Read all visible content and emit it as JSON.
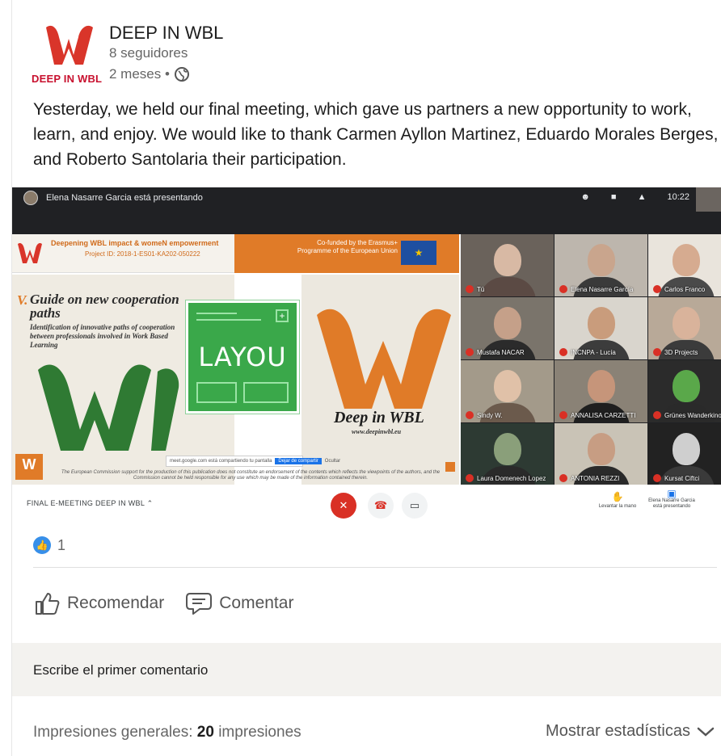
{
  "post": {
    "company_name": "DEEP IN WBL",
    "logo_text": "DEEP IN WBL",
    "followers": "8 seguidores",
    "time": "2 meses •",
    "body": "Yesterday, we held our final meeting, which gave us partners a new opportunity to work, learn, and enjoy. We would like to thank Carmen Ayllon Martinez, Eduardo Morales Berges, and Roberto Santolaria their participation."
  },
  "media": {
    "presenting_banner": "Elena Nasarre Garcia está presentando",
    "clock": "10:22",
    "slide": {
      "header_title": "Deepening WBL impact & womeN empowerment",
      "project_id": "Project ID: 2018-1-ES01-KA202-050222",
      "mini_logo_text": "DEEP IN WBL",
      "cofunded": "Co-funded by the Erasmus+ Programme of the European Union",
      "guide_number": "V.",
      "guide_title": "Guide on new cooperation paths",
      "guide_subtitle": "Identification of innovative paths of cooperation between professionals involved in Work Based Learning",
      "layou_label": "LAYOU",
      "deep_title": "Deep in WBL",
      "deep_url": "www.deepinwbl.eu",
      "share_text": "meet.google.com está compartiendo tu pantalla",
      "share_button": "Dejar de compartir",
      "share_hide": "Ocultar",
      "disclaimer": "The European Commission support for the production of this publication does not constitute an endorsement of the contents which reflects the viewpoints of the authors, and the Commission cannot be held responsible for any use which may be made of the information contained therein."
    },
    "participants": [
      {
        "name": "Tú"
      },
      {
        "name": "Elena Nasarre García"
      },
      {
        "name": "Carlos Franco"
      },
      {
        "name": "Mustafa NACAR"
      },
      {
        "name": "INCNPA - Lucía"
      },
      {
        "name": "3D Projects"
      },
      {
        "name": "Sindy W."
      },
      {
        "name": "ANNALISA CARZETTI"
      },
      {
        "name": "Grünes Wanderkino"
      },
      {
        "name": "Laura Domenech Lopez"
      },
      {
        "name": "ANTONIA REZZI"
      },
      {
        "name": "Kursat Ciftci"
      }
    ],
    "meeting_name": "FINAL E-MEETING DEEP IN WBL",
    "raise_hand": "Levantar la mano",
    "presenting_status": "Elena Nasarre Garcia está presentando"
  },
  "reactions": {
    "count": "1"
  },
  "actions": {
    "recommend": "Recomendar",
    "comment": "Comentar"
  },
  "comment_box": {
    "placeholder": "Escribe el primer comentario"
  },
  "footer": {
    "impressions_label": "Impresiones generales:",
    "impressions_count": "20",
    "impressions_unit": "impresiones",
    "show_stats": "Mostrar estadísticas"
  },
  "colors": {
    "brand_red": "#c8102e",
    "slide_orange": "#e07b28",
    "like_blue": "#378fe9"
  }
}
